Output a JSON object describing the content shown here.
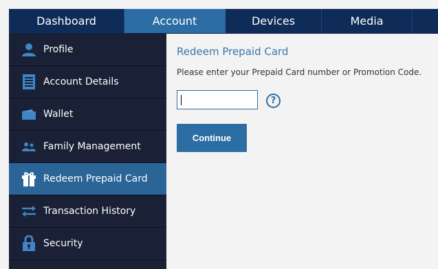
{
  "tabs": [
    {
      "label": "Dashboard",
      "active": false
    },
    {
      "label": "Account",
      "active": true
    },
    {
      "label": "Devices",
      "active": false
    },
    {
      "label": "Media",
      "active": false
    }
  ],
  "sidebar": {
    "items": [
      {
        "label": "Profile",
        "icon": "person-icon"
      },
      {
        "label": "Account Details",
        "icon": "document-icon"
      },
      {
        "label": "Wallet",
        "icon": "wallet-icon"
      },
      {
        "label": "Family Management",
        "icon": "family-icon"
      },
      {
        "label": "Redeem Prepaid Card",
        "icon": "gift-icon",
        "active": true
      },
      {
        "label": "Transaction History",
        "icon": "transfer-arrows-icon"
      },
      {
        "label": "Security",
        "icon": "lock-icon"
      }
    ]
  },
  "main": {
    "title": "Redeem Prepaid Card",
    "instruction": "Please enter your Prepaid Card number or Promotion Code.",
    "input_value": "",
    "help_symbol": "?",
    "continue_label": "Continue"
  },
  "colors": {
    "nav_bg": "#0f2b57",
    "active": "#2c6ea4",
    "sidebar_bg": "#1a2035",
    "content_bg": "#f3f3f3",
    "title": "#3a76a8"
  }
}
